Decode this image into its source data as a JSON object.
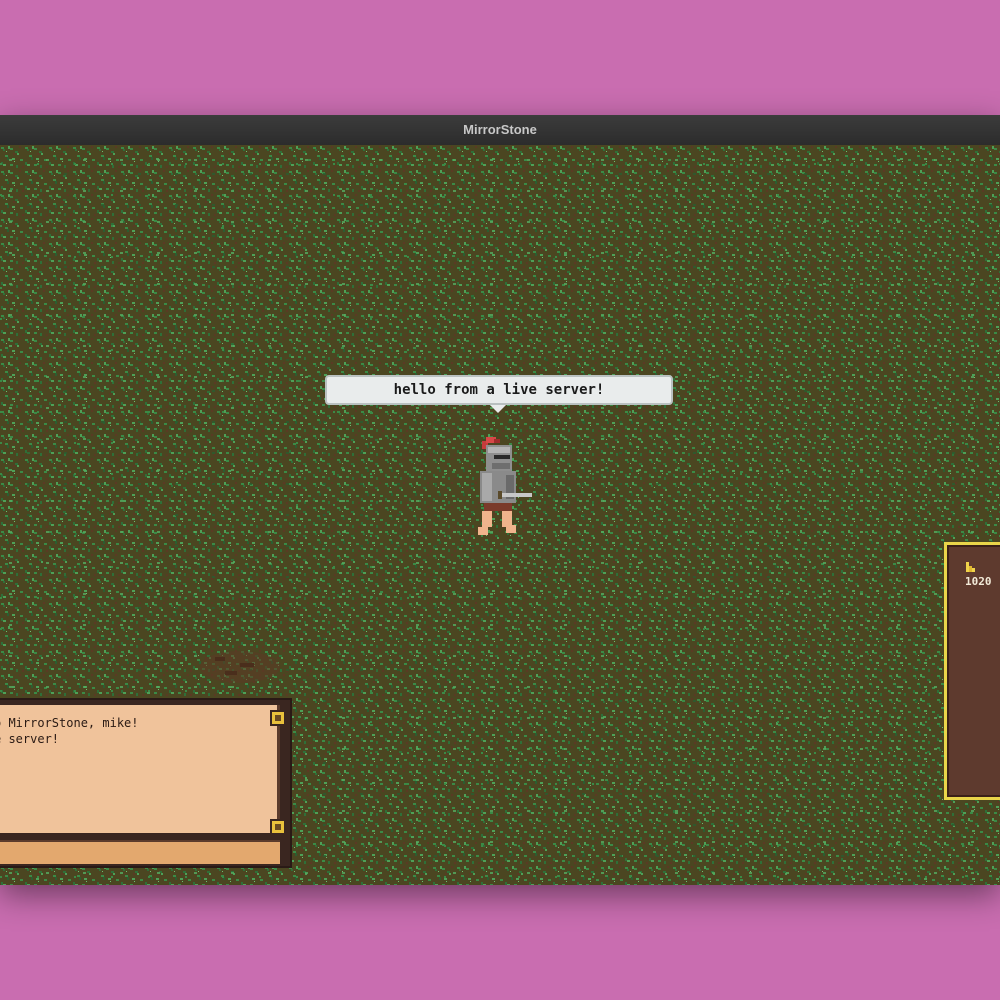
{
  "window": {
    "title": "MirrorStone"
  },
  "scene": {
    "speech_bubble": "hello from a live server!",
    "player_sprite": "armored-knight-with-red-plume"
  },
  "chat": {
    "lines": [
      "o MirrorStone, mike!",
      "e server!"
    ],
    "input_value": "",
    "scroll_up_icon": "scroll-up-icon",
    "scroll_down_icon": "scroll-down-icon"
  },
  "inventory": {
    "gold_icon": "gold-coin-icon",
    "gold": "1020"
  },
  "colors": {
    "background": "#c96db0",
    "grass_dark": "#4a4a22",
    "grass_light": "#3e8c45",
    "chat_bg": "#f0c39b",
    "panel_border": "#e9d54a"
  }
}
